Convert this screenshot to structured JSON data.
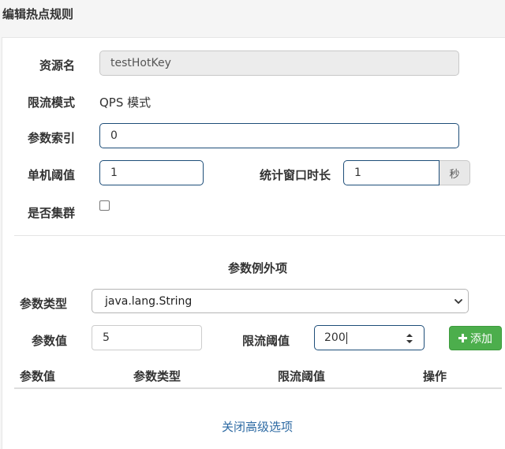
{
  "header": {
    "title": "编辑热点规则"
  },
  "form": {
    "resource_label": "资源名",
    "resource_value": "testHotKey",
    "limit_mode_label": "限流模式",
    "limit_mode_value": "QPS 模式",
    "param_index_label": "参数索引",
    "param_index_value": "0",
    "threshold_label": "单机阈值",
    "threshold_value": "1",
    "window_label": "统计窗口时长",
    "window_value": "1",
    "window_unit": "秒",
    "cluster_label": "是否集群",
    "cluster_checked": false
  },
  "exceptions": {
    "section_title": "参数例外项",
    "param_type_label": "参数类型",
    "param_type_selected": "java.lang.String",
    "param_value_label": "参数值",
    "param_value": "5",
    "limit_threshold_label": "限流阈值",
    "limit_threshold_value": "200",
    "add_button_label": "添加",
    "table_headers": [
      "参数值",
      "参数类型",
      "限流阈值",
      "操作"
    ],
    "rows": []
  },
  "footer": {
    "advanced_toggle_label": "关闭高级选项"
  },
  "colors": {
    "accent_border": "#1e4e79",
    "add_button": "#4cae4c",
    "link": "#2d6aa3"
  },
  "icons": {
    "add": "plus-icon",
    "select": "chevron-down-icon",
    "spinner": "spinner-arrows-icon"
  }
}
